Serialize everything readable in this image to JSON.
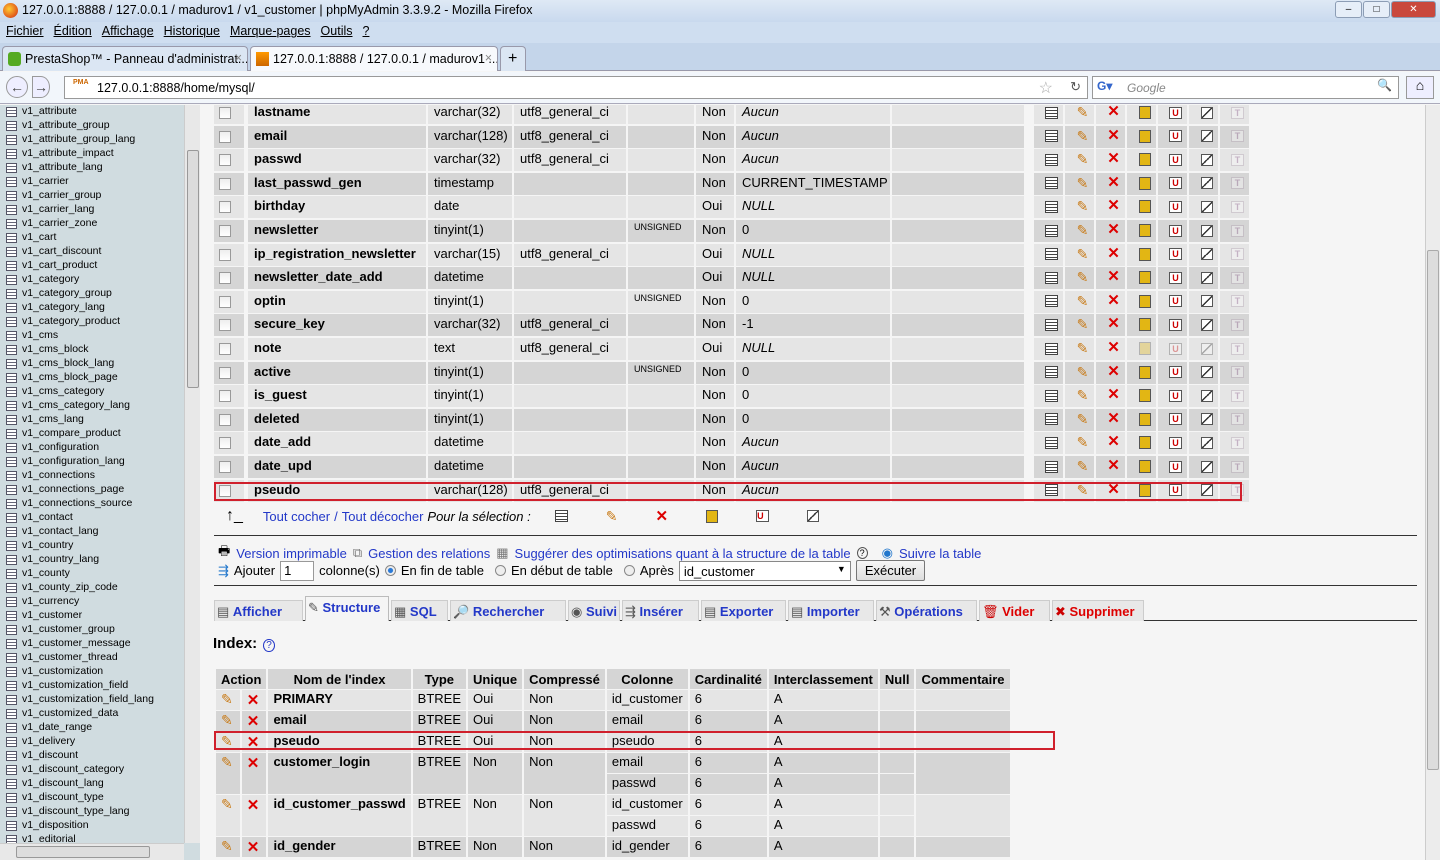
{
  "window": {
    "title": "127.0.0.1:8888 / 127.0.0.1 / madurov1 / v1_customer | phpMyAdmin 3.3.9.2 - Mozilla Firefox"
  },
  "menu": [
    "Fichier",
    "Édition",
    "Affichage",
    "Historique",
    "Marque-pages",
    "Outils",
    "?"
  ],
  "tabs": [
    {
      "label": "PrestaShop™ - Panneau d'administrat..."
    },
    {
      "label": "127.0.0.1:8888 / 127.0.0.1 / madurov1 ..."
    }
  ],
  "nav": {
    "url": "127.0.0.1:8888/home/mysql/",
    "search_placeholder": "Google",
    "new_tab": "+"
  },
  "sidebar": [
    "v1_attribute",
    "v1_attribute_group",
    "v1_attribute_group_lang",
    "v1_attribute_impact",
    "v1_attribute_lang",
    "v1_carrier",
    "v1_carrier_group",
    "v1_carrier_lang",
    "v1_carrier_zone",
    "v1_cart",
    "v1_cart_discount",
    "v1_cart_product",
    "v1_category",
    "v1_category_group",
    "v1_category_lang",
    "v1_category_product",
    "v1_cms",
    "v1_cms_block",
    "v1_cms_block_lang",
    "v1_cms_block_page",
    "v1_cms_category",
    "v1_cms_category_lang",
    "v1_cms_lang",
    "v1_compare_product",
    "v1_configuration",
    "v1_configuration_lang",
    "v1_connections",
    "v1_connections_page",
    "v1_connections_source",
    "v1_contact",
    "v1_contact_lang",
    "v1_country",
    "v1_country_lang",
    "v1_county",
    "v1_county_zip_code",
    "v1_currency",
    "v1_customer",
    "v1_customer_group",
    "v1_customer_message",
    "v1_customer_thread",
    "v1_customization",
    "v1_customization_field",
    "v1_customization_field_lang",
    "v1_customized_data",
    "v1_date_range",
    "v1_delivery",
    "v1_discount",
    "v1_discount_category",
    "v1_discount_lang",
    "v1_discount_type",
    "v1_discount_type_lang",
    "v1_disposition",
    "v1_editorial"
  ],
  "fields": [
    {
      "name": "lastname",
      "type": "varchar(32)",
      "collation": "utf8_general_ci",
      "attributes": "",
      "null": "Non",
      "default": "Aucun",
      "italic": true
    },
    {
      "name": "email",
      "type": "varchar(128)",
      "collation": "utf8_general_ci",
      "attributes": "",
      "null": "Non",
      "default": "Aucun",
      "italic": true
    },
    {
      "name": "passwd",
      "type": "varchar(32)",
      "collation": "utf8_general_ci",
      "attributes": "",
      "null": "Non",
      "default": "Aucun",
      "italic": true
    },
    {
      "name": "last_passwd_gen",
      "type": "timestamp",
      "collation": "",
      "attributes": "",
      "null": "Non",
      "default": "CURRENT_TIMESTAMP",
      "italic": false
    },
    {
      "name": "birthday",
      "type": "date",
      "collation": "",
      "attributes": "",
      "null": "Oui",
      "default": "NULL",
      "italic": true
    },
    {
      "name": "newsletter",
      "type": "tinyint(1)",
      "collation": "",
      "attributes": "UNSIGNED",
      "null": "Non",
      "default": "0",
      "italic": false
    },
    {
      "name": "ip_registration_newsletter",
      "type": "varchar(15)",
      "collation": "utf8_general_ci",
      "attributes": "",
      "null": "Oui",
      "default": "NULL",
      "italic": true
    },
    {
      "name": "newsletter_date_add",
      "type": "datetime",
      "collation": "",
      "attributes": "",
      "null": "Oui",
      "default": "NULL",
      "italic": true
    },
    {
      "name": "optin",
      "type": "tinyint(1)",
      "collation": "",
      "attributes": "UNSIGNED",
      "null": "Non",
      "default": "0",
      "italic": false
    },
    {
      "name": "secure_key",
      "type": "varchar(32)",
      "collation": "utf8_general_ci",
      "attributes": "",
      "null": "Non",
      "default": "-1",
      "italic": false
    },
    {
      "name": "note",
      "type": "text",
      "collation": "utf8_general_ci",
      "attributes": "",
      "null": "Oui",
      "default": "NULL",
      "italic": true,
      "index_disabled": true
    },
    {
      "name": "active",
      "type": "tinyint(1)",
      "collation": "",
      "attributes": "UNSIGNED",
      "null": "Non",
      "default": "0",
      "italic": false
    },
    {
      "name": "is_guest",
      "type": "tinyint(1)",
      "collation": "",
      "attributes": "",
      "null": "Non",
      "default": "0",
      "italic": false
    },
    {
      "name": "deleted",
      "type": "tinyint(1)",
      "collation": "",
      "attributes": "",
      "null": "Non",
      "default": "0",
      "italic": false
    },
    {
      "name": "date_add",
      "type": "datetime",
      "collation": "",
      "attributes": "",
      "null": "Non",
      "default": "Aucun",
      "italic": true
    },
    {
      "name": "date_upd",
      "type": "datetime",
      "collation": "",
      "attributes": "",
      "null": "Non",
      "default": "Aucun",
      "italic": true
    },
    {
      "name": "pseudo",
      "type": "varchar(128)",
      "collation": "utf8_general_ci",
      "attributes": "",
      "null": "Non",
      "default": "Aucun",
      "italic": true,
      "highlighted": true
    }
  ],
  "selection": {
    "check_all": "Tout cocher",
    "separator": " / ",
    "uncheck_all": "Tout décocher",
    "for_selection": "Pour la sélection :"
  },
  "links": {
    "print": "Version imprimable",
    "relations": "Gestion des relations",
    "optimize": "Suggérer des optimisations quant à la structure de la table",
    "help": "?",
    "track": "Suivre la table"
  },
  "add": {
    "label": "Ajouter",
    "count": "1",
    "columns_label": "colonne(s)",
    "at_end": "En fin de table",
    "at_start": "En début de table",
    "after": "Après",
    "after_value": "id_customer",
    "execute": "Exécuter"
  },
  "page_tabs": [
    "Afficher",
    "Structure",
    "SQL",
    "Rechercher",
    "Suivi",
    "Insérer",
    "Exporter",
    "Importer",
    "Opérations",
    "Vider",
    "Supprimer"
  ],
  "index": {
    "title": "Index:",
    "headers": [
      "Action",
      "Nom de l'index",
      "Type",
      "Unique",
      "Compressé",
      "Colonne",
      "Cardinalité",
      "Interclassement",
      "Null",
      "Commentaire"
    ],
    "rows": [
      {
        "name": "PRIMARY",
        "type": "BTREE",
        "unique": "Oui",
        "packed": "Non",
        "columns": [
          {
            "col": "id_customer",
            "card": "6",
            "coll": "A",
            "null": ""
          }
        ],
        "comment": ""
      },
      {
        "name": "email",
        "type": "BTREE",
        "unique": "Oui",
        "packed": "Non",
        "columns": [
          {
            "col": "email",
            "card": "6",
            "coll": "A",
            "null": ""
          }
        ],
        "comment": ""
      },
      {
        "name": "pseudo",
        "type": "BTREE",
        "unique": "Oui",
        "packed": "Non",
        "columns": [
          {
            "col": "pseudo",
            "card": "6",
            "coll": "A",
            "null": ""
          }
        ],
        "comment": ""
      },
      {
        "name": "customer_login",
        "type": "BTREE",
        "unique": "Non",
        "packed": "Non",
        "columns": [
          {
            "col": "email",
            "card": "6",
            "coll": "A",
            "null": ""
          },
          {
            "col": "passwd",
            "card": "6",
            "coll": "A",
            "null": ""
          }
        ],
        "comment": ""
      },
      {
        "name": "id_customer_passwd",
        "type": "BTREE",
        "unique": "Non",
        "packed": "Non",
        "columns": [
          {
            "col": "id_customer",
            "card": "6",
            "coll": "A",
            "null": ""
          },
          {
            "col": "passwd",
            "card": "6",
            "coll": "A",
            "null": ""
          }
        ],
        "comment": ""
      },
      {
        "name": "id_gender",
        "type": "BTREE",
        "unique": "Non",
        "packed": "Non",
        "columns": [
          {
            "col": "id_gender",
            "card": "6",
            "coll": "A",
            "null": ""
          }
        ],
        "comment": ""
      }
    ]
  }
}
